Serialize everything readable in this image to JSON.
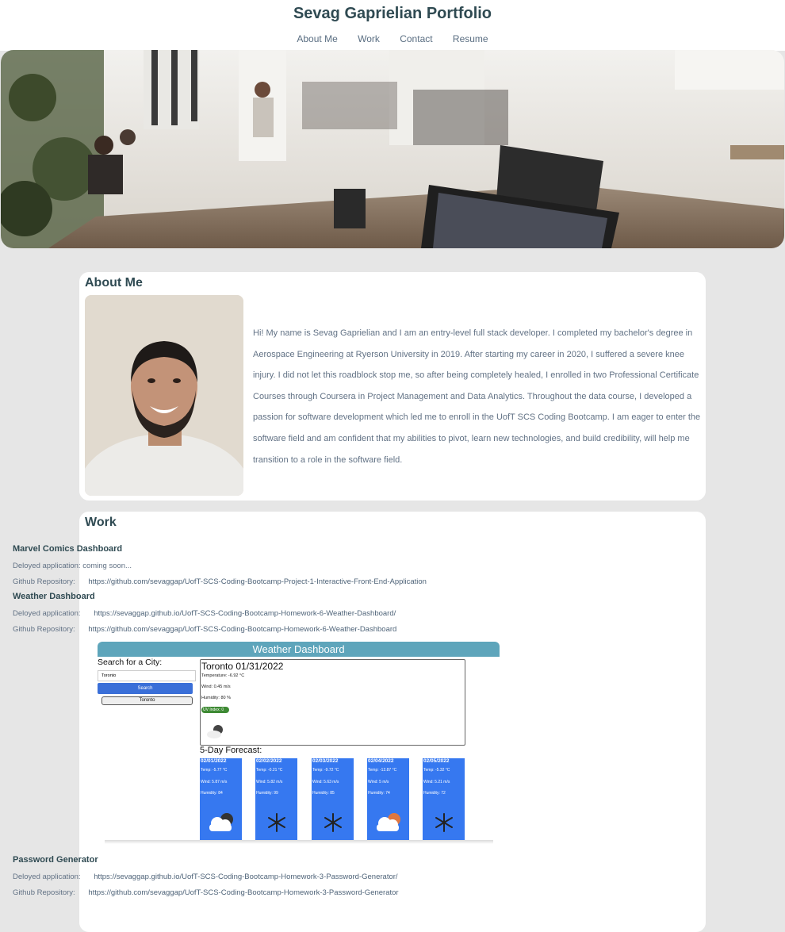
{
  "header": {
    "title": "Sevag Gaprielian Portfolio",
    "nav": [
      "About Me",
      "Work",
      "Contact",
      "Resume"
    ]
  },
  "about": {
    "heading": "About Me",
    "text": "Hi! My name is Sevag Gaprielian and I am an entry-level full stack developer. I completed my bachelor's degree in Aerospace Engineering at Ryerson University in 2019. After starting my career in 2020, I suffered a severe knee injury. I did not let this roadblock stop me, so after being completely healed, I enrolled in two Professional Certificate Courses through Coursera in Project Management and Data Analytics. Throughout the data course, I developed a passion for software development which led me to enroll in the UofT SCS Coding Bootcamp. I am eager to enter the software field and am confident that my abilities to pivot, learn new technologies, and build credibility, will help me transition to a role in the software field."
  },
  "work": {
    "heading": "Work",
    "projects": [
      {
        "name": "Marvel Comics Dashboard",
        "deployed_label": "Deloyed application: coming soon...",
        "deployed_url": "",
        "repo_label": "Github Repository:",
        "repo_url": "https://github.com/sevaggap/UofT-SCS-Coding-Bootcamp-Project-1-Interactive-Front-End-Application"
      },
      {
        "name": "Weather Dashboard",
        "deployed_label": "Deloyed application:",
        "deployed_url": "https://sevaggap.github.io/UofT-SCS-Coding-Bootcamp-Homework-6-Weather-Dashboard/",
        "repo_label": "Github Repository:",
        "repo_url": "https://github.com/sevaggap/UofT-SCS-Coding-Bootcamp-Homework-6-Weather-Dashboard"
      },
      {
        "name": "Password Generator",
        "deployed_label": "Deloyed application:",
        "deployed_url": "https://sevaggap.github.io/UofT-SCS-Coding-Bootcamp-Homework-3-Password-Generator/",
        "repo_label": "Github Repository:",
        "repo_url": "https://github.com/sevaggap/UofT-SCS-Coding-Bootcamp-Homework-3-Password-Generator"
      }
    ]
  },
  "weather_screenshot": {
    "header": "Weather Dashboard",
    "search_label": "Search for a City:",
    "input_value": "Toronto",
    "search_button": "Search",
    "history_button": "Toronto",
    "today": {
      "city_date": "Toronto 01/31/2022",
      "temp": "Temperature: -6.92 °C",
      "wind": "Wind: 0.45 m/s",
      "humidity": "Humidity: 80 %",
      "uv": "UV Index: 0"
    },
    "forecast_title": "5-Day Forecast:",
    "forecast": [
      {
        "date": "02/01/2022",
        "temp": "Temp: -5.77 °C",
        "wind": "Wind: 5.87 m/s",
        "humidity": "Humidity: 84",
        "icon": "cloudy-icon"
      },
      {
        "date": "02/02/2022",
        "temp": "Temp: -0.21 °C",
        "wind": "Wind: 5.82 m/s",
        "humidity": "Humidity: 99",
        "icon": "snowflake-icon"
      },
      {
        "date": "02/03/2022",
        "temp": "Temp: -9.72 °C",
        "wind": "Wind: 5.63 m/s",
        "humidity": "Humidity: 85",
        "icon": "snowflake-icon"
      },
      {
        "date": "02/04/2022",
        "temp": "Temp: -12.87 °C",
        "wind": "Wind: 5 m/s",
        "humidity": "Humidity: 74",
        "icon": "partly-cloudy-icon"
      },
      {
        "date": "02/05/2022",
        "temp": "Temp: -5.32 °C",
        "wind": "Wind: 5.21 m/s",
        "humidity": "Humidity: 72",
        "icon": "snowflake-icon"
      }
    ]
  },
  "colors": {
    "background": "#e6e6e6",
    "heading": "#2f4a52",
    "body_text": "#627285",
    "weather_header": "#5ea5bb",
    "forecast_card": "#3678f0",
    "uv_badge": "#3e8a34"
  }
}
